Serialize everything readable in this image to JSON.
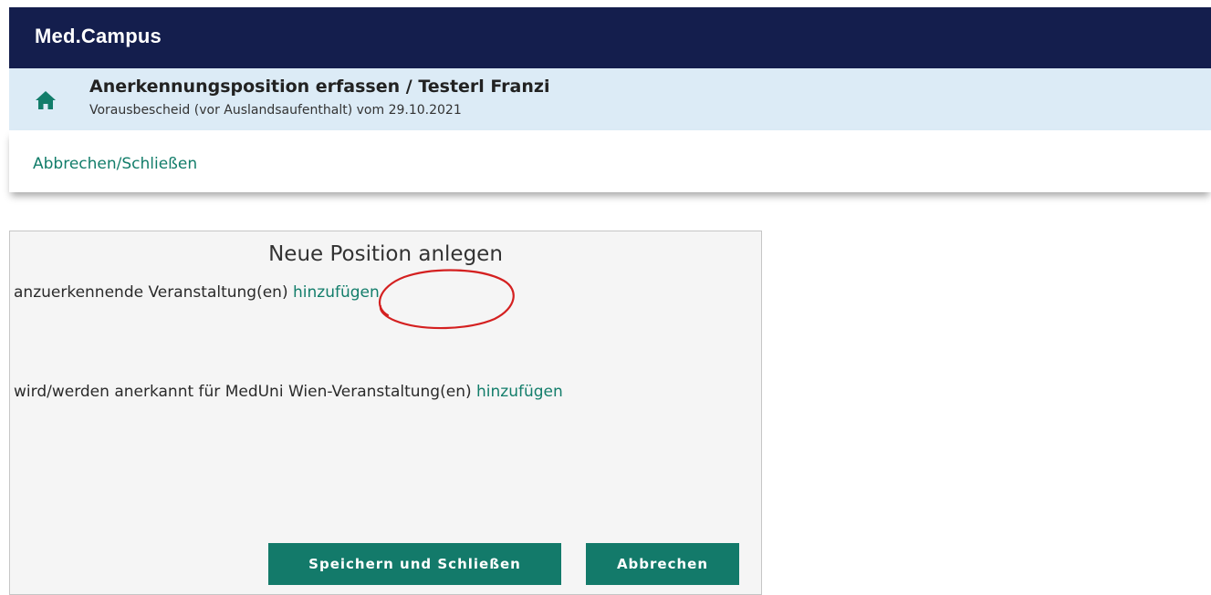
{
  "header": {
    "app_title": "Med.Campus"
  },
  "subheader": {
    "home_icon": "home-icon",
    "title": "Anerkennungsposition erfassen  / Testerl Franzi",
    "subtitle": "Vorausbescheid (vor Auslandsaufenthalt) vom 29.10.2021"
  },
  "actions": {
    "cancel_close_label": "Abbrechen/Schließen"
  },
  "panel": {
    "title": "Neue Position anlegen",
    "row1_label": "anzuerkennende Veranstaltung(en)",
    "row1_link": "hinzufügen",
    "row2_label": "wird/werden anerkannt für MedUni Wien-Veranstaltung(en)",
    "row2_link": "hinzufügen",
    "save_button": "Speichern und Schließen",
    "cancel_button": "Abbrechen"
  },
  "colors": {
    "header_bg": "#141e4d",
    "subheader_bg": "#dcebf6",
    "accent": "#137a6a",
    "annotation": "#d42020"
  }
}
